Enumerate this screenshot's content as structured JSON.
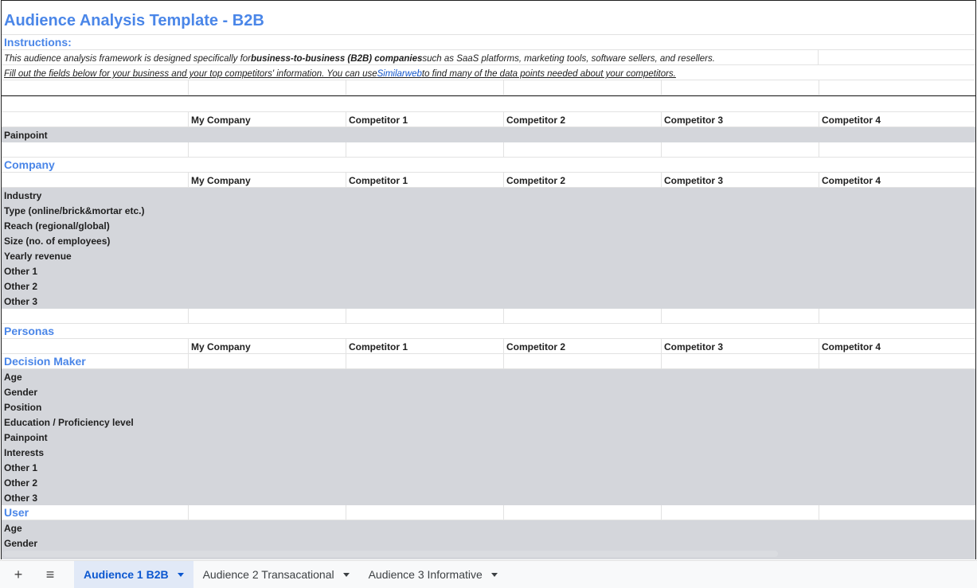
{
  "title": "Audience Analysis Template - B2B",
  "instructions": {
    "label": "Instructions:",
    "line1_pre": "This audience analysis framework is designed specifically for ",
    "line1_bold": "business-to-business (B2B) companies",
    "line1_post": " such as SaaS platforms, marketing tools, software sellers, and resellers.",
    "line2_pre": "Fill out the fields below for your business and your top competitors' information. You can use ",
    "line2_link": "Similarweb",
    "line2_post": " to find many of the data points needed about your competitors."
  },
  "columns": [
    "My Company",
    "Competitor 1",
    "Competitor 2",
    "Competitor 3",
    "Competitor 4"
  ],
  "painpoint_label": "Painpoint",
  "company": {
    "title": "Company",
    "rows": [
      "Industry",
      "Type (online/brick&mortar etc.)",
      "Reach (regional/global)",
      "Size (no. of employees)",
      "Yearly revenue",
      "Other 1",
      "Other 2",
      "Other 3"
    ]
  },
  "personas": {
    "title": "Personas",
    "decision_maker": {
      "title": "Decision Maker",
      "rows": [
        "Age",
        "Gender",
        "Position",
        "Education / Proficiency level",
        "Painpoint",
        "Interests",
        "Other 1",
        "Other 2",
        "Other 3"
      ]
    },
    "user": {
      "title": "User",
      "rows": [
        "Age",
        "Gender"
      ]
    }
  },
  "tabs": {
    "add_label": "+",
    "list_label": "≡",
    "items": [
      "Audience 1 B2B",
      "Audience 2 Transacational",
      "Audience 3 Informative"
    ],
    "active_index": 0
  }
}
